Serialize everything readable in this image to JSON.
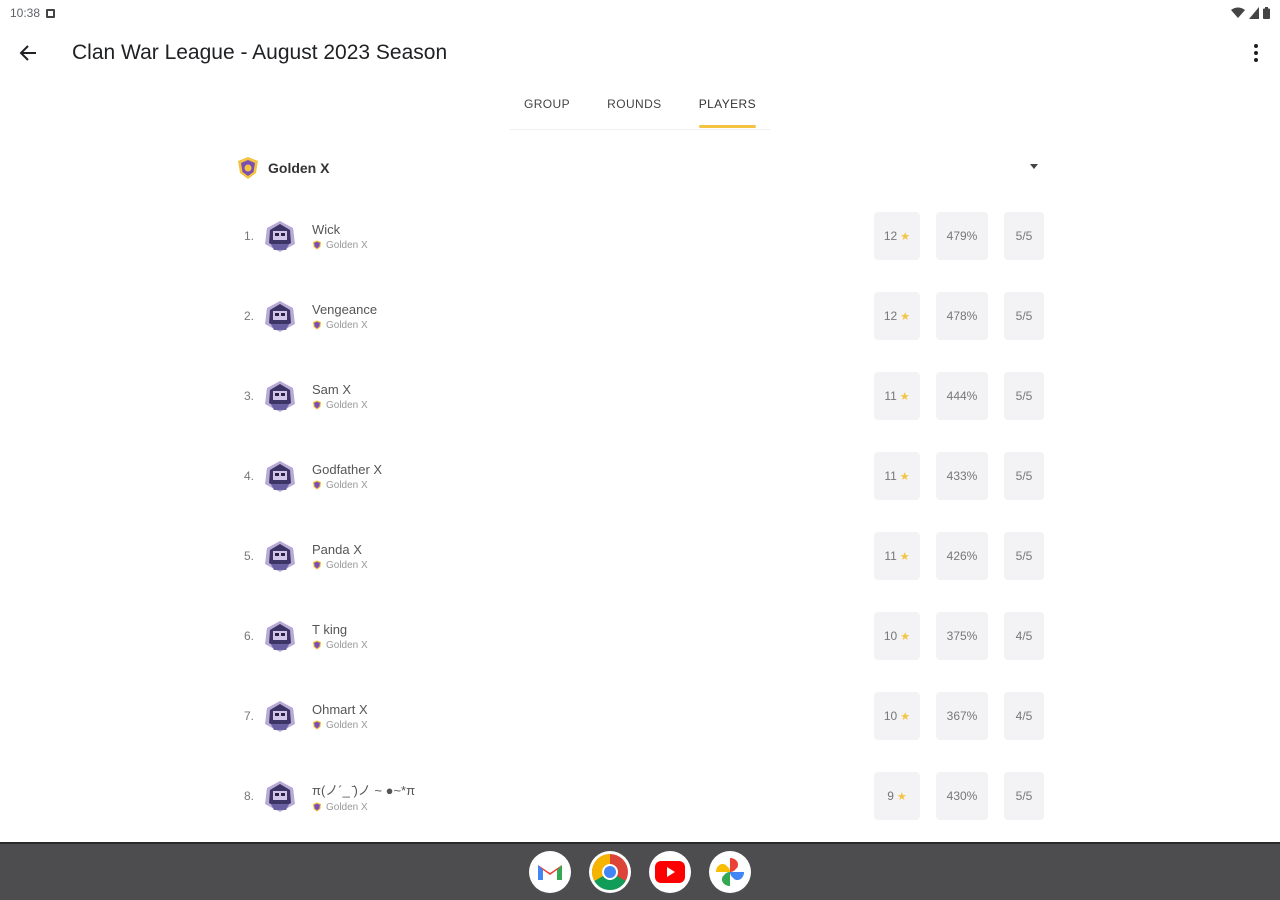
{
  "status_bar": {
    "time": "10:38"
  },
  "app_bar": {
    "title": "Clan War League - August 2023 Season"
  },
  "tabs": [
    {
      "label": "GROUP",
      "active": false
    },
    {
      "label": "ROUNDS",
      "active": false
    },
    {
      "label": "PLAYERS",
      "active": true
    }
  ],
  "clan_selector": {
    "name": "Golden X"
  },
  "players": [
    {
      "rank": "1.",
      "name": "Wick",
      "clan": "Golden X",
      "stars": "12",
      "percent": "479%",
      "attacks": "5/5"
    },
    {
      "rank": "2.",
      "name": "Vengeance",
      "clan": "Golden X",
      "stars": "12",
      "percent": "478%",
      "attacks": "5/5"
    },
    {
      "rank": "3.",
      "name": "Sam X",
      "clan": "Golden X",
      "stars": "11",
      "percent": "444%",
      "attacks": "5/5"
    },
    {
      "rank": "4.",
      "name": "Godfather X",
      "clan": "Golden X",
      "stars": "11",
      "percent": "433%",
      "attacks": "5/5"
    },
    {
      "rank": "5.",
      "name": "Panda X",
      "clan": "Golden X",
      "stars": "11",
      "percent": "426%",
      "attacks": "5/5"
    },
    {
      "rank": "6.",
      "name": "T king",
      "clan": "Golden X",
      "stars": "10",
      "percent": "375%",
      "attacks": "4/5"
    },
    {
      "rank": "7.",
      "name": "Ohmart X",
      "clan": "Golden X",
      "stars": "10",
      "percent": "367%",
      "attacks": "4/5"
    },
    {
      "rank": "8.",
      "name": "π(ノ´_ ̄)ノ ~ ●~*π",
      "clan": "Golden X",
      "stars": "9",
      "percent": "430%",
      "attacks": "5/5"
    }
  ],
  "dock": [
    {
      "name": "Gmail",
      "icon": "gmail-icon"
    },
    {
      "name": "Chrome",
      "icon": "chrome-icon"
    },
    {
      "name": "YouTube",
      "icon": "youtube-icon"
    },
    {
      "name": "Photos",
      "icon": "photos-icon"
    }
  ],
  "colors": {
    "accent": "#f5c342",
    "chip_bg": "#f3f3f5",
    "taskbar": "#4d4d4f"
  }
}
